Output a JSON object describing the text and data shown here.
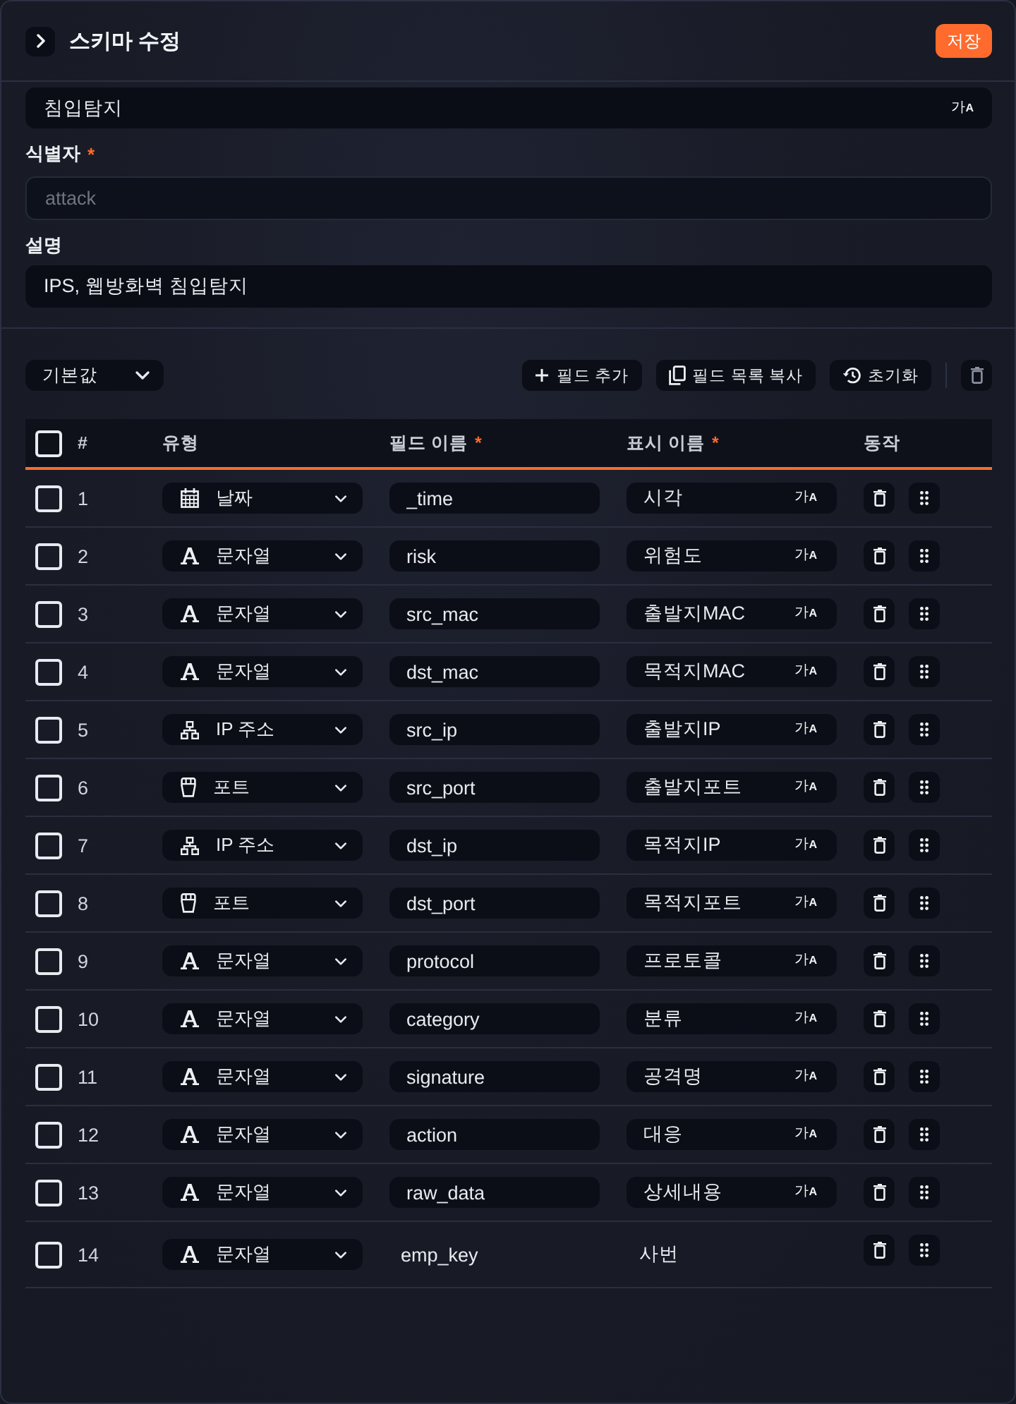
{
  "header": {
    "title": "스키마 수정",
    "save_button": "저장"
  },
  "name_field": {
    "value": "침입탐지",
    "translate": "$^{가}$$_{A}$"
  },
  "identifier": {
    "label": "식별자",
    "required_mark": "*",
    "placeholder": "attack"
  },
  "description": {
    "label": "설명",
    "value": "IPS, 웹방화벽 침입탐지"
  },
  "toolbar": {
    "preset_select": "기본값",
    "buttons": [
      {
        "kind": "add",
        "label": "필드 추가"
      },
      {
        "kind": "copy",
        "label": "필드 목록 복사"
      },
      {
        "kind": "reset",
        "label": "초기화"
      },
      {
        "kind": "delete"
      }
    ]
  },
  "table": {
    "select_all": {
      "checked": false
    },
    "columns": [
      {
        "label": "#"
      },
      {
        "label": "유형"
      },
      {
        "label": "필드 이름",
        "required_mark": "*"
      },
      {
        "label": "표시 이름",
        "required_mark": "*"
      },
      {
        "label": "동작"
      }
    ],
    "rows": [
      {
        "number": "1",
        "checked": false,
        "type": {
          "kind": "date",
          "label": "날짜"
        },
        "editable": true,
        "field_name": "_time",
        "display_name": "시각",
        "translate": "$^{가}$$_{A}$"
      },
      {
        "number": "2",
        "checked": false,
        "type": {
          "kind": "string",
          "label": "문자열"
        },
        "editable": true,
        "field_name": "risk",
        "display_name": "위험도",
        "translate": "$^{가}$$_{A}$"
      },
      {
        "number": "3",
        "checked": false,
        "type": {
          "kind": "string",
          "label": "문자열"
        },
        "editable": true,
        "field_name": "src_mac",
        "display_name": "출발지MAC",
        "translate": "$^{가}$$_{A}$"
      },
      {
        "number": "4",
        "checked": false,
        "type": {
          "kind": "string",
          "label": "문자열"
        },
        "editable": true,
        "field_name": "dst_mac",
        "display_name": "목적지MAC",
        "translate": "$^{가}$$_{A}$"
      },
      {
        "number": "5",
        "checked": false,
        "type": {
          "kind": "ip",
          "label": "IP 주소"
        },
        "editable": true,
        "field_name": "src_ip",
        "display_name": "출발지IP",
        "translate": "$^{가}$$_{A}$"
      },
      {
        "number": "6",
        "checked": false,
        "type": {
          "kind": "port",
          "label": "포트"
        },
        "editable": true,
        "field_name": "src_port",
        "display_name": "출발지포트",
        "translate": "$^{가}$$_{A}$"
      },
      {
        "number": "7",
        "checked": false,
        "type": {
          "kind": "ip",
          "label": "IP 주소"
        },
        "editable": true,
        "field_name": "dst_ip",
        "display_name": "목적지IP",
        "translate": "$^{가}$$_{A}$"
      },
      {
        "number": "8",
        "checked": false,
        "type": {
          "kind": "port",
          "label": "포트"
        },
        "editable": true,
        "field_name": "dst_port",
        "display_name": "목적지포트",
        "translate": "$^{가}$$_{A}$"
      },
      {
        "number": "9",
        "checked": false,
        "type": {
          "kind": "string",
          "label": "문자열"
        },
        "editable": true,
        "field_name": "protocol",
        "display_name": "프로토콜",
        "translate": "$^{가}$$_{A}$"
      },
      {
        "number": "10",
        "checked": false,
        "type": {
          "kind": "string",
          "label": "문자열"
        },
        "editable": true,
        "field_name": "category",
        "display_name": "분류",
        "translate": "$^{가}$$_{A}$"
      },
      {
        "number": "11",
        "checked": false,
        "type": {
          "kind": "string",
          "label": "문자열"
        },
        "editable": true,
        "field_name": "signature",
        "display_name": "공격명",
        "translate": "$^{가}$$_{A}$"
      },
      {
        "number": "12",
        "checked": false,
        "type": {
          "kind": "string",
          "label": "문자열"
        },
        "editable": true,
        "field_name": "action",
        "display_name": "대응",
        "translate": "$^{가}$$_{A}$"
      },
      {
        "number": "13",
        "checked": false,
        "type": {
          "kind": "string",
          "label": "문자열"
        },
        "editable": true,
        "field_name": "raw_data",
        "display_name": "상세내용",
        "translate": "$^{가}$$_{A}$"
      },
      {
        "number": "14",
        "checked": false,
        "type": {
          "kind": "string",
          "label": "문자열"
        },
        "editable": false,
        "field_name": "emp_key",
        "display_name": "사번"
      }
    ]
  }
}
